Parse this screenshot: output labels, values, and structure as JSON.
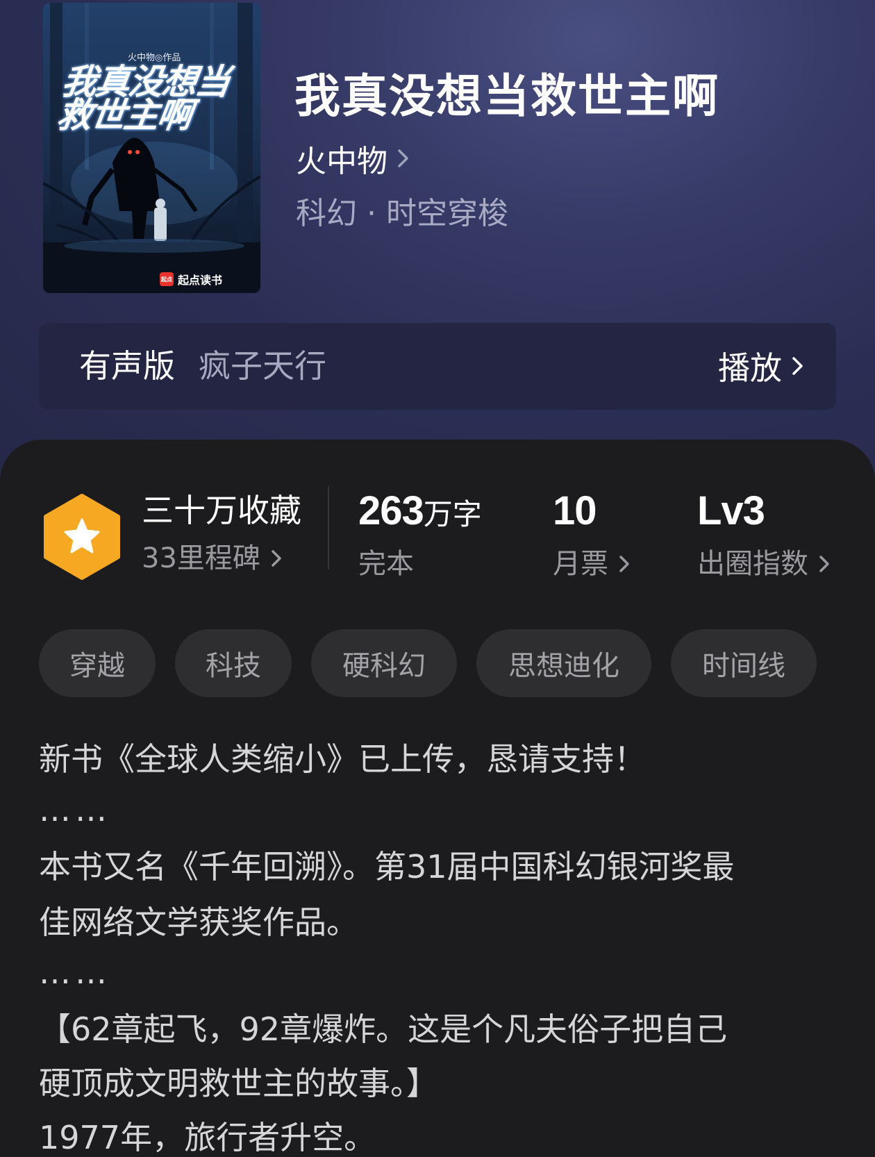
{
  "book": {
    "title": "我真没想当救世主啊",
    "author": "火中物",
    "category": "科幻 · 时空穿梭"
  },
  "cover": {
    "author_line": "火中物◎作品",
    "title_line1": "我真没想当",
    "title_line2": "救世主啊",
    "publisher": "起点读书",
    "publisher_logo": "起点"
  },
  "audio": {
    "label": "有声版",
    "narrator": "疯子天行",
    "play_label": "播放"
  },
  "stats": {
    "collection_title": "三十万收藏",
    "milestones": "33里程碑",
    "word_count": "263",
    "word_unit": "万字",
    "status": "完本",
    "monthly_votes": "10",
    "monthly_votes_label": "月票",
    "level": "Lv3",
    "level_label": "出圈指数"
  },
  "tags": [
    "穿越",
    "科技",
    "硬科幻",
    "思想迪化",
    "时间线"
  ],
  "description": {
    "line1": "新书《全球人类缩小》已上传，恳请支持！",
    "sep1": "……",
    "line2": "本书又名《千年回溯》。第31届中国科幻银河奖最",
    "line3": "佳网络文学获奖作品。",
    "sep2": "……",
    "line4": "【62章起飞，92章爆炸。这是个凡夫俗子把自己",
    "line5": "硬顶成文明救世主的故事。】",
    "line6": "1977年，旅行者升空。"
  },
  "colors": {
    "header_bg": "#2b2e54",
    "panel_bg": "#1c1c1e",
    "badge": "#f7a823",
    "tag_bg": "#2e2e30"
  }
}
